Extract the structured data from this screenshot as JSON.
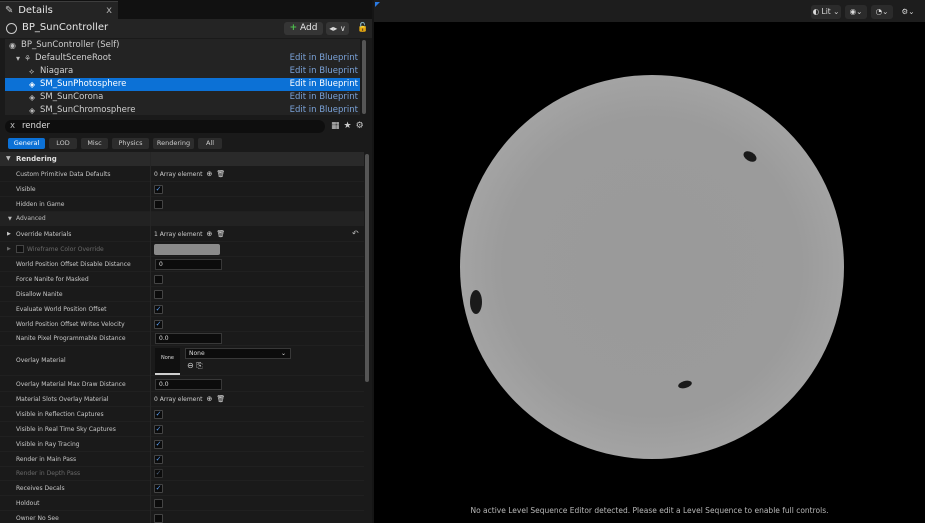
{
  "left_panel": {
    "tab": {
      "label": "Details",
      "close": "x"
    },
    "header": {
      "title": "BP_SunController",
      "add_label": "Add",
      "blueprint_label": "◂▸ ∨"
    },
    "tree": [
      {
        "label": "BP_SunController (Self)",
        "edit": ""
      },
      {
        "label": "DefaultSceneRoot",
        "edit": "Edit in Blueprint"
      },
      {
        "label": "Niagara",
        "edit": "Edit in Blueprint"
      },
      {
        "label": "SM_SunPhotosphere",
        "edit": "Edit in Blueprint"
      },
      {
        "label": "SM_SunCorona",
        "edit": "Edit in Blueprint"
      },
      {
        "label": "SM_SunChromosphere",
        "edit": "Edit in Blueprint"
      }
    ],
    "search": {
      "value": "render",
      "clear": "x"
    },
    "filter_tabs": [
      "General",
      "LOD",
      "Misc",
      "Physics",
      "Rendering",
      "All"
    ],
    "section": "Rendering",
    "advanced_label": "Advanced",
    "props": {
      "custom_primitive": {
        "label": "Custom Primitive Data Defaults",
        "value": "0 Array element"
      },
      "visible": {
        "label": "Visible"
      },
      "hidden_in_game": {
        "label": "Hidden in Game"
      },
      "override_materials": {
        "label": "Override Materials",
        "value": "1 Array element"
      },
      "wireframe_color": {
        "label": "Wireframe Color Override"
      },
      "wpo_disable": {
        "label": "World Position Offset Disable Distance",
        "value": "0"
      },
      "force_nanite": {
        "label": "Force Nanite for Masked"
      },
      "disallow_nanite": {
        "label": "Disallow Nanite"
      },
      "eval_wpo": {
        "label": "Evaluate World Position Offset"
      },
      "wpo_velocity": {
        "label": "World Position Offset Writes Velocity"
      },
      "nanite_pixel": {
        "label": "Nanite Pixel Programmable Distance",
        "value": "0.0"
      },
      "overlay_material": {
        "label": "Overlay Material",
        "thumb": "None",
        "select": "None"
      },
      "overlay_max": {
        "label": "Overlay Material Max Draw Distance",
        "value": "0.0"
      },
      "slots_overlay": {
        "label": "Material Slots Overlay Material",
        "value": "0 Array element"
      },
      "vis_reflection": {
        "label": "Visible in Reflection Captures"
      },
      "vis_sky": {
        "label": "Visible in Real Time Sky Captures"
      },
      "vis_ray": {
        "label": "Visible in Ray Tracing"
      },
      "main_pass": {
        "label": "Render in Main Pass"
      },
      "depth_pass": {
        "label": "Render in Depth Pass"
      },
      "receives_decals": {
        "label": "Receives Decals"
      },
      "holdout": {
        "label": "Holdout"
      },
      "owner_no_see": {
        "label": "Owner No See"
      }
    }
  },
  "viewport": {
    "lit_label": "Lit",
    "message": "No active Level Sequence Editor detected. Please edit a Level Sequence to enable full controls."
  },
  "colors": {
    "accent": "#0c71d6",
    "panel": "#1a1a1a",
    "viewport": "#000000"
  }
}
